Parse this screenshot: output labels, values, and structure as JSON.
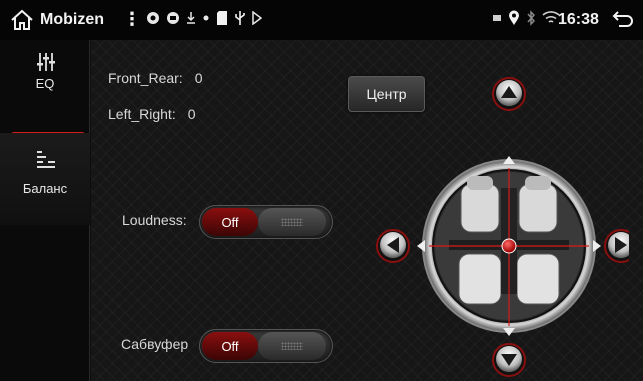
{
  "statusbar": {
    "app_title": "Mobizen",
    "menu": "⋮",
    "time": "16:38"
  },
  "sidebar": {
    "tabs": [
      {
        "label": "EQ",
        "icon": "equalizer-sliders-icon",
        "active": false
      },
      {
        "label": "Баланс",
        "icon": "balance-bars-icon",
        "active": true
      }
    ]
  },
  "balance": {
    "front_rear_label": "Front_Rear:",
    "front_rear_value": "0",
    "left_right_label": "Left_Right:",
    "left_right_value": "0",
    "center_button": "Центр"
  },
  "loudness": {
    "label": "Loudness:",
    "state": "Off"
  },
  "subwoofer": {
    "label": "Сабвуфер",
    "state": "Off"
  },
  "colors": {
    "accent": "#d71b1b",
    "background": "#161616"
  }
}
